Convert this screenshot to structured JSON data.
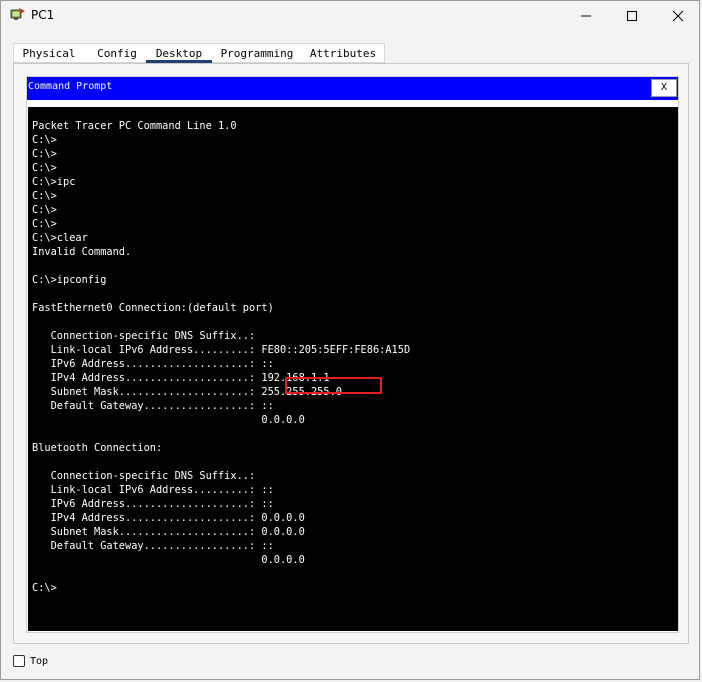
{
  "window": {
    "title": "PC1"
  },
  "tabs": [
    {
      "label": "Physical"
    },
    {
      "label": "Config"
    },
    {
      "label": "Desktop"
    },
    {
      "label": "Programming"
    },
    {
      "label": "Attributes"
    }
  ],
  "active_tab": "Desktop",
  "command_prompt": {
    "title": "Command Prompt",
    "close_label": "X",
    "lines": [
      "Packet Tracer PC Command Line 1.0",
      "C:\\>",
      "C:\\>",
      "C:\\>",
      "C:\\>ipc",
      "C:\\>",
      "C:\\>",
      "C:\\>",
      "C:\\>clear",
      "Invalid Command.",
      "",
      "C:\\>ipconfig",
      "",
      "FastEthernet0 Connection:(default port)",
      "",
      "   Connection-specific DNS Suffix..: ",
      "   Link-local IPv6 Address.........: FE80::205:5EFF:FE86:A15D",
      "   IPv6 Address....................: ::",
      "   IPv4 Address....................: 192.168.1.1",
      "   Subnet Mask.....................: 255.255.255.0",
      "   Default Gateway.................: ::",
      "                                     0.0.0.0",
      "",
      "Bluetooth Connection:",
      "",
      "   Connection-specific DNS Suffix..: ",
      "   Link-local IPv6 Address.........: ::",
      "   IPv6 Address....................: ::",
      "   IPv4 Address....................: 0.0.0.0",
      "   Subnet Mask.....................: 0.0.0.0",
      "   Default Gateway.................: ::",
      "                                     0.0.0.0",
      "",
      "C:\\>"
    ]
  },
  "footer": {
    "top_label": "Top",
    "top_checked": false
  },
  "colors": {
    "header_blue": "#0000ff",
    "terminal_bg": "#000000",
    "terminal_text": "#ffffff",
    "highlight_red": "#e02020",
    "active_tab_underline": "#1f3e73"
  }
}
